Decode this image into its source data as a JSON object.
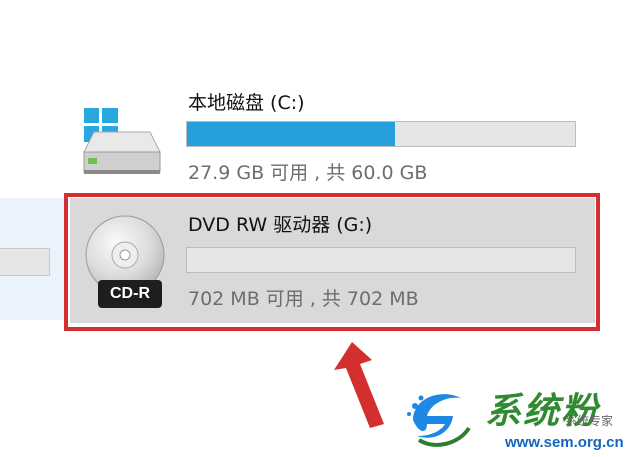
{
  "drives": [
    {
      "name": "本地磁盘 (C:)",
      "space": "27.9 GB 可用 , 共 60.0 GB",
      "used_fraction": 0.535,
      "bar_color": "#26a0da",
      "icon": "hard-drive-icon"
    },
    {
      "name": "DVD RW 驱动器 (G:)",
      "space": "702 MB 可用 , 共 702 MB",
      "used_fraction": 0,
      "badge": "CD-R",
      "icon": "cd-disc-icon",
      "selected": true
    }
  ],
  "annotation": {
    "box_color": "#d32f2f",
    "arrow_color": "#d32f2f"
  },
  "watermark": {
    "title": "系统粉",
    "subtitle": "系统专家",
    "url": "www.sem.org.cn"
  }
}
